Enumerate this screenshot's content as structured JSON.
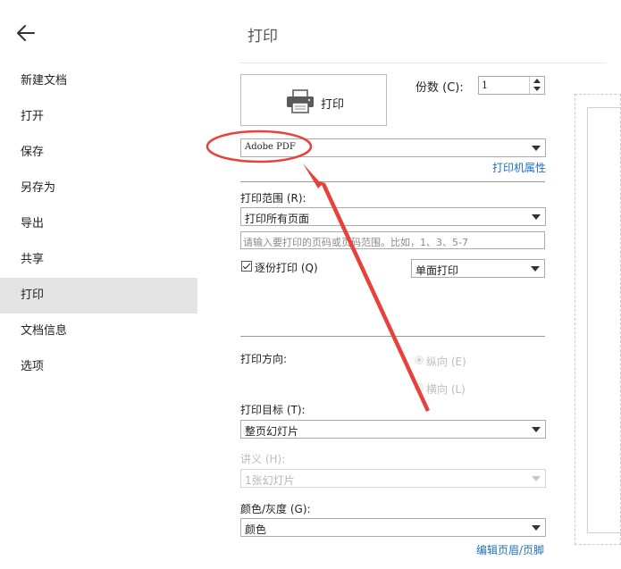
{
  "sidebar": {
    "back_icon": "arrow-left-icon",
    "items": [
      {
        "label": "新建文档"
      },
      {
        "label": "打开"
      },
      {
        "label": "保存"
      },
      {
        "label": "另存为"
      },
      {
        "label": "导出"
      },
      {
        "label": "共享"
      },
      {
        "label": "打印",
        "active": true
      },
      {
        "label": "文档信息"
      },
      {
        "label": "选项"
      }
    ]
  },
  "main": {
    "title": "打印",
    "print_button": {
      "label": "打印",
      "icon": "printer-icon"
    },
    "copies": {
      "label": "份数 (C):",
      "value": "1"
    },
    "printer": {
      "selected": "Adobe PDF",
      "properties_link": "打印机属性"
    },
    "range": {
      "label": "打印范围 (R):",
      "selected": "打印所有页面",
      "placeholder": "请输入要打印的页码或页码范围。比如，1、3、5-7"
    },
    "collate": {
      "label": "逐份打印 (Q)",
      "checked": true
    },
    "sides": {
      "selected": "单面打印"
    },
    "orientation": {
      "label": "打印方向:",
      "portrait": "纵向 (E)",
      "landscape": "横向 (L)"
    },
    "target": {
      "label": "打印目标 (T):",
      "selected": "整页幻灯片"
    },
    "handout": {
      "label": "讲义 (H):",
      "selected": "1张幻灯片"
    },
    "color": {
      "label": "颜色/灰度 (G):",
      "selected": "颜色"
    },
    "header_footer_link": "编辑页眉/页脚"
  },
  "annotation": {
    "color": "#e8403a"
  },
  "colors": {
    "accent": "#1f6fbf",
    "active_nav": "#e4e4e4"
  }
}
